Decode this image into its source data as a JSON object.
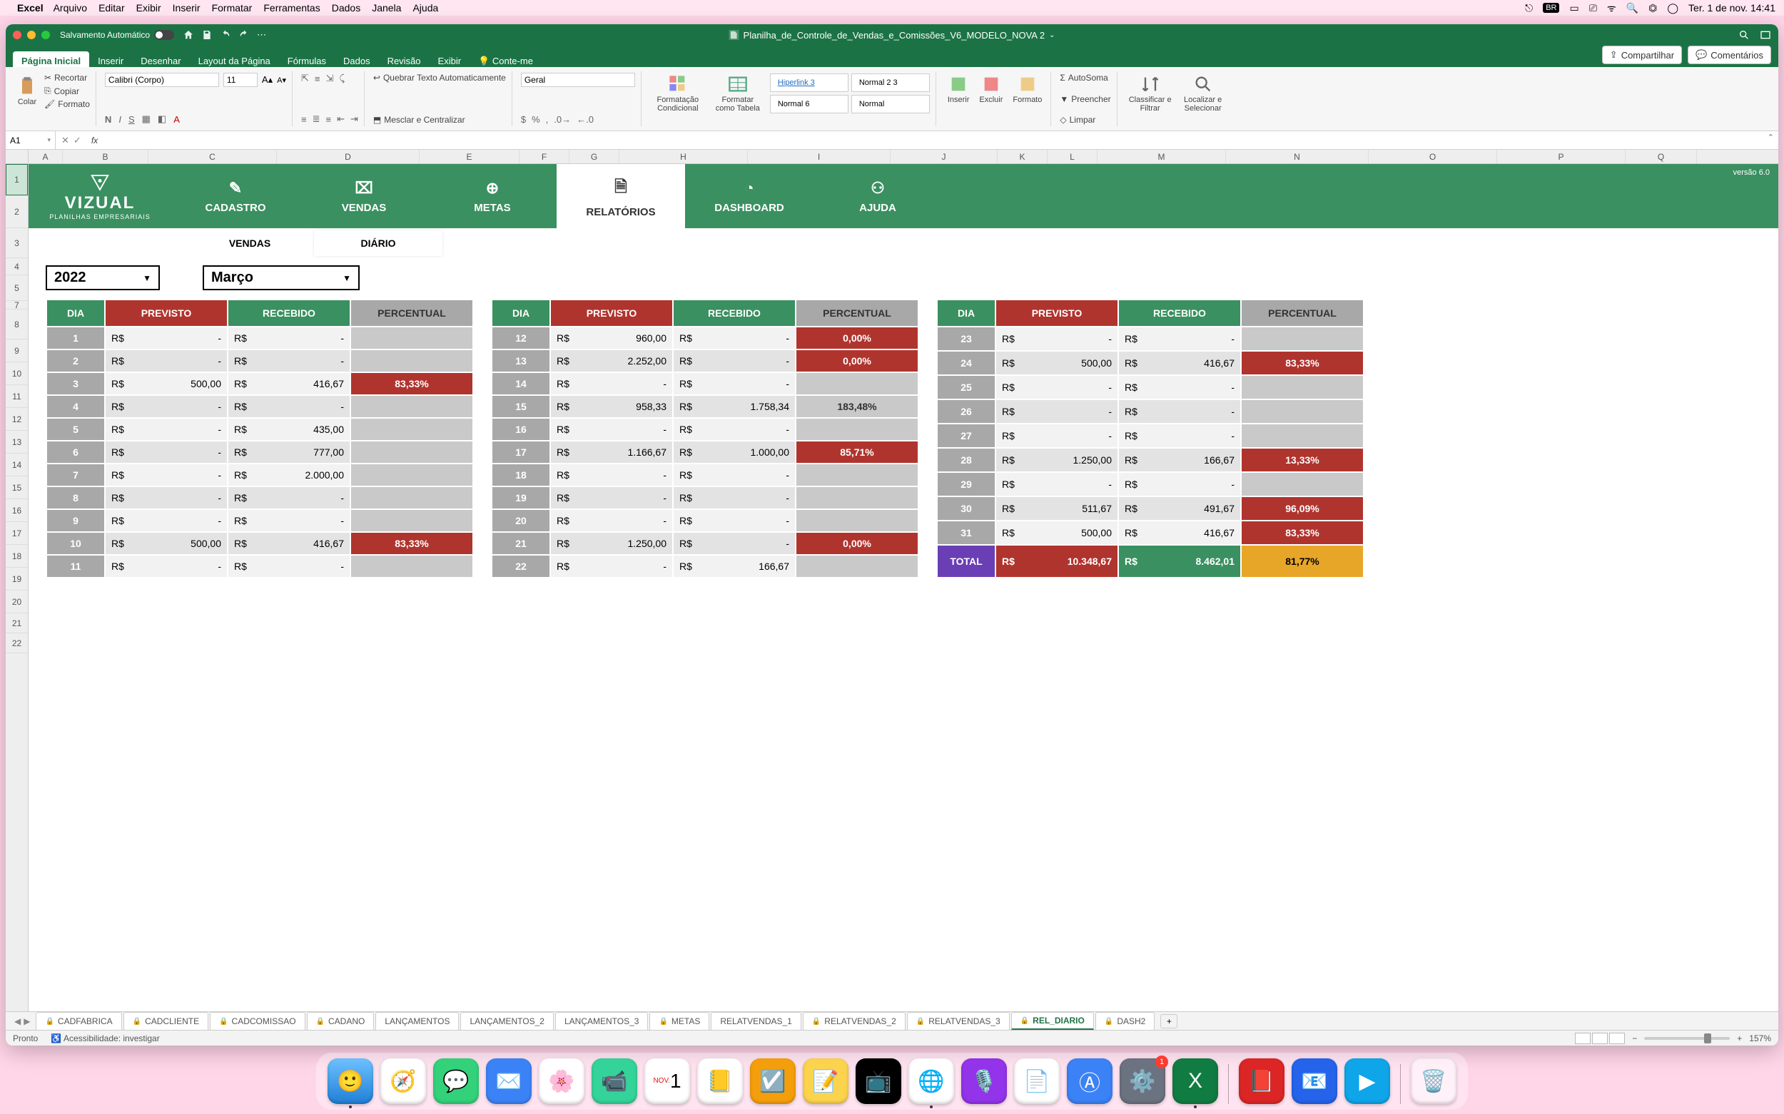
{
  "mac_menu": {
    "app": "Excel",
    "items": [
      "Arquivo",
      "Editar",
      "Exibir",
      "Inserir",
      "Formatar",
      "Ferramentas",
      "Dados",
      "Janela",
      "Ajuda"
    ],
    "right_status": "Ter. 1 de nov.  14:41",
    "lang": "BR"
  },
  "window": {
    "autosave": "Salvamento Automático",
    "title": "Planilha_de_Controle_de_Vendas_e_Comissões_V6_MODELO_NOVA 2",
    "share": "Compartilhar",
    "comments": "Comentários"
  },
  "tabs": [
    "Página Inicial",
    "Inserir",
    "Desenhar",
    "Layout da Página",
    "Fórmulas",
    "Dados",
    "Revisão",
    "Exibir",
    "Conte-me"
  ],
  "ribbon": {
    "paste": "Colar",
    "cut": "Recortar",
    "copy": "Copiar",
    "format_painter": "Formato",
    "font_name": "Calibri (Corpo)",
    "font_size": "11",
    "wrap": "Quebrar Texto Automaticamente",
    "merge": "Mesclar e Centralizar",
    "number_format": "Geral",
    "cond_format": "Formatação Condicional",
    "as_table": "Formatar como Tabela",
    "styles": {
      "a": "Hiperlink 3",
      "b": "Normal 2 3",
      "c": "Normal 6",
      "d": "Normal"
    },
    "insert": "Inserir",
    "delete": "Excluir",
    "format": "Formato",
    "autosum": "AutoSoma",
    "fill": "Preencher",
    "clear": "Limpar",
    "sort": "Classificar e Filtrar",
    "find": "Localizar e Selecionar"
  },
  "formula": {
    "cell": "A1"
  },
  "columns": [
    "A",
    "B",
    "C",
    "D",
    "E",
    "F",
    "G",
    "H",
    "I",
    "J",
    "K",
    "L",
    "M",
    "N",
    "O",
    "P",
    "Q"
  ],
  "rows": [
    "1",
    "2",
    "3",
    "4",
    "5",
    "7",
    "8",
    "9",
    "10",
    "11",
    "12",
    "13",
    "14",
    "15",
    "16",
    "17",
    "18",
    "19",
    "20",
    "21",
    "22"
  ],
  "nav": {
    "brand": "VIZUAL",
    "brand_sub": "PLANILHAS EMPRESARIAIS",
    "items": [
      "CADASTRO",
      "VENDAS",
      "METAS",
      "RELATÓRIOS",
      "DASHBOARD",
      "AJUDA"
    ],
    "version": "versão 6.0"
  },
  "subtabs": [
    "VENDAS",
    "DIÁRIO"
  ],
  "filters": {
    "year": "2022",
    "month": "Março"
  },
  "headers": {
    "dia": "DIA",
    "previsto": "PREVISTO",
    "recebido": "RECEBIDO",
    "percentual": "PERCENTUAL"
  },
  "currency": "R$",
  "table1": [
    {
      "d": "1",
      "p": "-",
      "r": "-",
      "pc": "",
      "cls": ""
    },
    {
      "d": "2",
      "p": "-",
      "r": "-",
      "pc": "",
      "cls": ""
    },
    {
      "d": "3",
      "p": "500,00",
      "r": "416,67",
      "pc": "83,33%",
      "cls": "red"
    },
    {
      "d": "4",
      "p": "-",
      "r": "-",
      "pc": "",
      "cls": ""
    },
    {
      "d": "5",
      "p": "-",
      "r": "435,00",
      "pc": "",
      "cls": ""
    },
    {
      "d": "6",
      "p": "-",
      "r": "777,00",
      "pc": "",
      "cls": ""
    },
    {
      "d": "7",
      "p": "-",
      "r": "2.000,00",
      "pc": "",
      "cls": ""
    },
    {
      "d": "8",
      "p": "-",
      "r": "-",
      "pc": "",
      "cls": ""
    },
    {
      "d": "9",
      "p": "-",
      "r": "-",
      "pc": "",
      "cls": ""
    },
    {
      "d": "10",
      "p": "500,00",
      "r": "416,67",
      "pc": "83,33%",
      "cls": "red"
    },
    {
      "d": "11",
      "p": "-",
      "r": "-",
      "pc": "",
      "cls": ""
    }
  ],
  "table2": [
    {
      "d": "12",
      "p": "960,00",
      "r": "-",
      "pc": "0,00%",
      "cls": "red"
    },
    {
      "d": "13",
      "p": "2.252,00",
      "r": "-",
      "pc": "0,00%",
      "cls": "red"
    },
    {
      "d": "14",
      "p": "-",
      "r": "-",
      "pc": "",
      "cls": ""
    },
    {
      "d": "15",
      "p": "958,33",
      "r": "1.758,34",
      "pc": "183,48%",
      "cls": "gray"
    },
    {
      "d": "16",
      "p": "-",
      "r": "-",
      "pc": "",
      "cls": ""
    },
    {
      "d": "17",
      "p": "1.166,67",
      "r": "1.000,00",
      "pc": "85,71%",
      "cls": "red"
    },
    {
      "d": "18",
      "p": "-",
      "r": "-",
      "pc": "",
      "cls": ""
    },
    {
      "d": "19",
      "p": "-",
      "r": "-",
      "pc": "",
      "cls": ""
    },
    {
      "d": "20",
      "p": "-",
      "r": "-",
      "pc": "",
      "cls": ""
    },
    {
      "d": "21",
      "p": "1.250,00",
      "r": "-",
      "pc": "0,00%",
      "cls": "red"
    },
    {
      "d": "22",
      "p": "-",
      "r": "166,67",
      "pc": "",
      "cls": ""
    }
  ],
  "table3": [
    {
      "d": "23",
      "p": "-",
      "r": "-",
      "pc": "",
      "cls": ""
    },
    {
      "d": "24",
      "p": "500,00",
      "r": "416,67",
      "pc": "83,33%",
      "cls": "red"
    },
    {
      "d": "25",
      "p": "-",
      "r": "-",
      "pc": "",
      "cls": ""
    },
    {
      "d": "26",
      "p": "-",
      "r": "-",
      "pc": "",
      "cls": ""
    },
    {
      "d": "27",
      "p": "-",
      "r": "-",
      "pc": "",
      "cls": ""
    },
    {
      "d": "28",
      "p": "1.250,00",
      "r": "166,67",
      "pc": "13,33%",
      "cls": "red"
    },
    {
      "d": "29",
      "p": "-",
      "r": "-",
      "pc": "",
      "cls": ""
    },
    {
      "d": "30",
      "p": "511,67",
      "r": "491,67",
      "pc": "96,09%",
      "cls": "red"
    },
    {
      "d": "31",
      "p": "500,00",
      "r": "416,67",
      "pc": "83,33%",
      "cls": "red"
    }
  ],
  "total": {
    "label": "TOTAL",
    "previsto": "10.348,67",
    "recebido": "8.462,01",
    "percentual": "81,77%"
  },
  "sheet_tabs": [
    {
      "name": "CADFABRICA",
      "lock": true
    },
    {
      "name": "CADCLIENTE",
      "lock": true
    },
    {
      "name": "CADCOMISSAO",
      "lock": true
    },
    {
      "name": "CADANO",
      "lock": true
    },
    {
      "name": "LANÇAMENTOS",
      "lock": false
    },
    {
      "name": "LANÇAMENTOS_2",
      "lock": false
    },
    {
      "name": "LANÇAMENTOS_3",
      "lock": false
    },
    {
      "name": "METAS",
      "lock": true
    },
    {
      "name": "RELATVENDAS_1",
      "lock": false
    },
    {
      "name": "RELATVENDAS_2",
      "lock": true
    },
    {
      "name": "RELATVENDAS_3",
      "lock": true
    },
    {
      "name": "REL_DIARIO",
      "lock": true,
      "active": true
    },
    {
      "name": "DASH2",
      "lock": true
    }
  ],
  "status": {
    "ready": "Pronto",
    "access": "Acessibilidade: investigar",
    "zoom": "157%"
  },
  "chart_data": {
    "type": "table",
    "title": "Relatório Diário — Março 2022",
    "columns": [
      "DIA",
      "PREVISTO (R$)",
      "RECEBIDO (R$)",
      "PERCENTUAL"
    ],
    "rows": [
      [
        "1",
        null,
        null,
        null
      ],
      [
        "2",
        null,
        null,
        null
      ],
      [
        "3",
        500.0,
        416.67,
        83.33
      ],
      [
        "4",
        null,
        null,
        null
      ],
      [
        "5",
        null,
        435.0,
        null
      ],
      [
        "6",
        null,
        777.0,
        null
      ],
      [
        "7",
        null,
        2000.0,
        null
      ],
      [
        "8",
        null,
        null,
        null
      ],
      [
        "9",
        null,
        null,
        null
      ],
      [
        "10",
        500.0,
        416.67,
        83.33
      ],
      [
        "11",
        null,
        null,
        null
      ],
      [
        "12",
        960.0,
        null,
        0.0
      ],
      [
        "13",
        2252.0,
        null,
        0.0
      ],
      [
        "14",
        null,
        null,
        null
      ],
      [
        "15",
        958.33,
        1758.34,
        183.48
      ],
      [
        "16",
        null,
        null,
        null
      ],
      [
        "17",
        1166.67,
        1000.0,
        85.71
      ],
      [
        "18",
        null,
        null,
        null
      ],
      [
        "19",
        null,
        null,
        null
      ],
      [
        "20",
        null,
        null,
        null
      ],
      [
        "21",
        1250.0,
        null,
        0.0
      ],
      [
        "22",
        null,
        166.67,
        null
      ],
      [
        "23",
        null,
        null,
        null
      ],
      [
        "24",
        500.0,
        416.67,
        83.33
      ],
      [
        "25",
        null,
        null,
        null
      ],
      [
        "26",
        null,
        null,
        null
      ],
      [
        "27",
        null,
        null,
        null
      ],
      [
        "28",
        1250.0,
        166.67,
        13.33
      ],
      [
        "29",
        null,
        null,
        null
      ],
      [
        "30",
        511.67,
        491.67,
        96.09
      ],
      [
        "31",
        500.0,
        416.67,
        83.33
      ]
    ],
    "total": {
      "previsto": 10348.67,
      "recebido": 8462.01,
      "percentual": 81.77
    }
  }
}
